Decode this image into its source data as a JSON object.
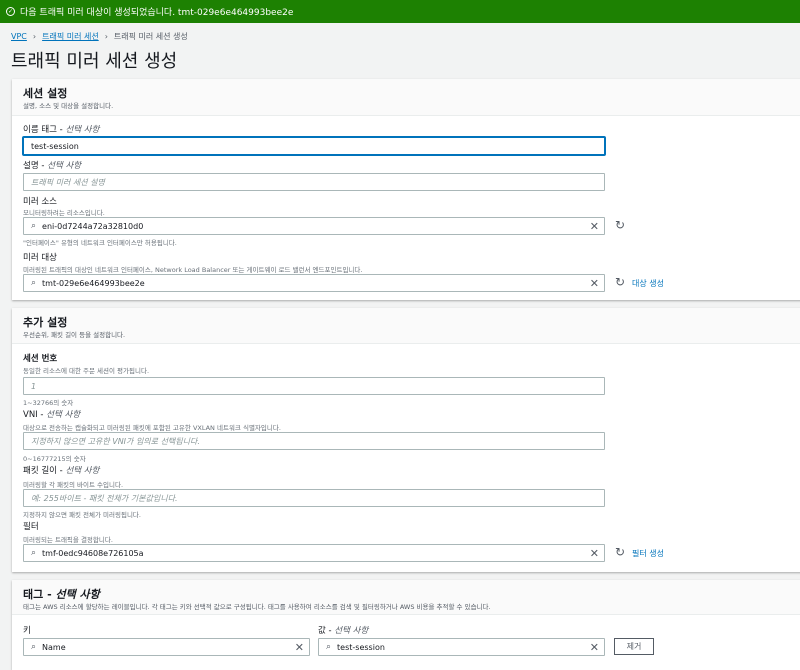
{
  "banner": {
    "message": "다음 트래픽 미러 대상이 생성되었습니다. tmt-029e6e464993bee2e",
    "icon": "check-circle-icon"
  },
  "breadcrumb": [
    "VPC",
    "트래픽 미러 세션",
    "트래픽 미러 세션 생성"
  ],
  "page_title": "트래픽 미러 세션 생성",
  "session_settings": {
    "title": "세션 설정",
    "description": "설명, 소스 및 대상을 설정합니다.",
    "name_tag": {
      "label": "이름 태그 - ",
      "optional": "선택 사항",
      "value": "test-session"
    },
    "description_field": {
      "label": "설명 - ",
      "optional": "선택 사항",
      "placeholder": "트래픽 미러 세션 설명"
    },
    "mirror_source": {
      "label": "미러 소스",
      "description": "모니터링하려는 리소스입니다.",
      "value": "eni-0d7244a72a32810d0",
      "hint": "\"인터페이스\" 유형의 네트워크 인터페이스만 허용됩니다."
    },
    "mirror_target": {
      "label": "미러 대상",
      "description": "미러링된 트래픽의 대상인 네트워크 인터페이스, Network Load Balancer 또는 게이트웨이 로드 밸런서 엔드포인트입니다.",
      "value": "tmt-029e6e464993bee2e",
      "create_link": "대상 생성"
    }
  },
  "additional_settings": {
    "title": "추가 설정",
    "description": "우선순위, 패킷 길이 등을 설정합니다.",
    "session_number": {
      "label": "세션 번호",
      "description": "동일한 리소스에 대한 주문 세션이 평가됩니다.",
      "value": "1",
      "hint": "1~32766의 숫자"
    },
    "vni": {
      "label": "VNI - ",
      "optional": "선택 사항",
      "description": "대상으로 전송하는 캡슐화되고 미러링된 패킷에 포함된 고유한 VXLAN 네트워크 식별자입니다.",
      "placeholder": "지정하지 않으면 고유한 VNI가 임의로 선택됩니다.",
      "hint": "0~16777215의 숫자"
    },
    "packet_length": {
      "label": "패킷 길이 - ",
      "optional": "선택 사항",
      "description": "미러링할 각 패킷의 바이트 수입니다.",
      "placeholder": "예: 255바이트 - 패킷 전체가 기본값입니다.",
      "hint": "지정하지 않으면 패킷 전체가 미러링됩니다."
    },
    "filter": {
      "label": "필터",
      "description": "미러링되는 트래픽을 결정합니다.",
      "value": "tmf-0edc94608e726105a",
      "create_link": "필터 생성"
    }
  },
  "tags": {
    "title": "태그 - ",
    "optional": "선택 사항",
    "description": "태그는 AWS 리소스에 할당하는 레이블입니다. 각 태그는 키와 선택적 값으로 구성됩니다. 태그를 사용하여 리소스를 검색 및 필터링하거나 AWS 비용을 추적할 수 있습니다.",
    "key_label": "키",
    "value_label": "값 - ",
    "value_optional": "선택 사항",
    "key": "Name",
    "value": "test-session",
    "remove_label": "제거"
  }
}
